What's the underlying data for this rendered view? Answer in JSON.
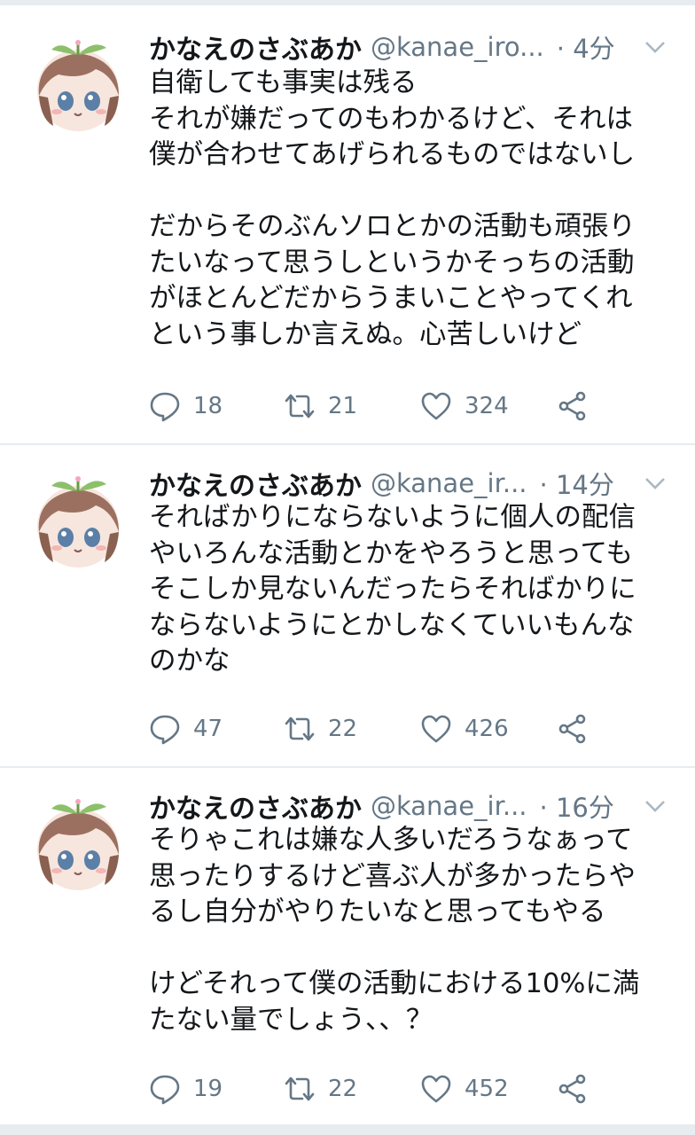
{
  "colors": {
    "text": "#14171a",
    "secondary": "#657786",
    "divider": "#e6ecf0",
    "accent": "#8ecdf8"
  },
  "tweets": [
    {
      "name": "かなえのさぶあか",
      "handle": "@kanae_iro...",
      "time": "· 4分",
      "lines": [
        "自衛しても事実は残る",
        "それが嫌だってのもわかるけど、それは",
        "僕が合わせてあげられるものではないし",
        "",
        "だからそのぶんソロとかの活動も頑張り",
        "たいなって思うしというかそっちの活動",
        "がほとんどだからうまいことやってくれ",
        "という事しか言えぬ。心苦しいけど"
      ],
      "replies": "18",
      "retweets": "21",
      "likes": "324"
    },
    {
      "name": "かなえのさぶあか",
      "handle": "@kanae_ir...",
      "time": "· 14分",
      "lines": [
        "そればかりにならないように個人の配信",
        "やいろんな活動とかをやろうと思っても",
        "そこしか見ないんだったらそればかりに",
        "ならないようにとかしなくていいもんな",
        "のかな"
      ],
      "replies": "47",
      "retweets": "22",
      "likes": "426"
    },
    {
      "name": "かなえのさぶあか",
      "handle": "@kanae_ir...",
      "time": "· 16分",
      "lines": [
        "そりゃこれは嫌な人多いだろうなぁって",
        "思ったりするけど喜ぶ人が多かったらや",
        "るし自分がやりたいなと思ってもやる",
        "",
        "けどそれって僕の活動における10%に満",
        "たない量でしょう、、？"
      ],
      "replies": "19",
      "retweets": "22",
      "likes": "452"
    }
  ]
}
